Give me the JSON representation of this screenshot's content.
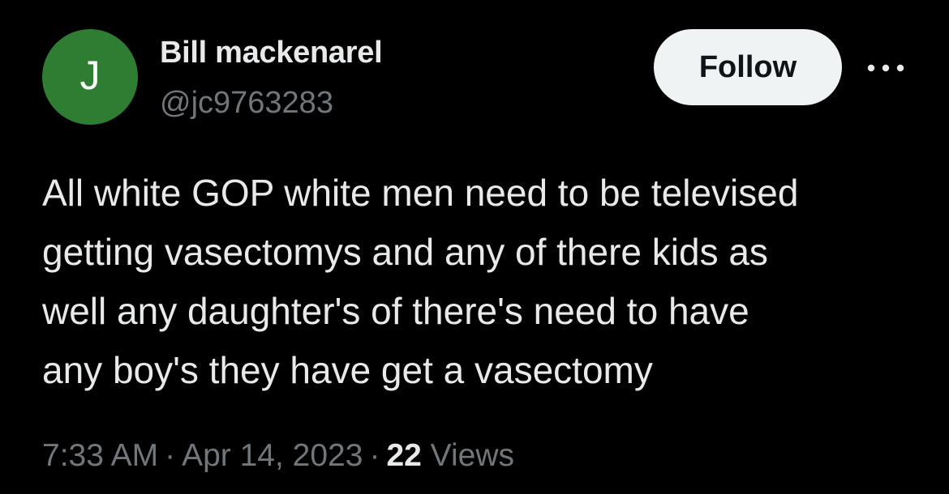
{
  "author": {
    "avatar_letter": "J",
    "display_name": "Bill mackenarel",
    "handle": "@jc9763283",
    "avatar_color": "#2e7d32"
  },
  "actions": {
    "follow_label": "Follow",
    "more_icon": "more-horizontal-icon"
  },
  "tweet": {
    "lines": [
      "All white GOP white men need to be televised",
      "getting vasectomys and any of there kids as",
      "well any daughter's of there's need to have",
      "any boy's they have get a vasectomy"
    ]
  },
  "meta": {
    "time": "7:33 AM",
    "separator": "·",
    "date": "Apr 14, 2023",
    "views_count": "22",
    "views_label": "Views"
  },
  "colors": {
    "background": "#000000",
    "primary_text": "#e7e9ea",
    "secondary_text": "#71767b",
    "button_bg": "#eff3f4",
    "button_text": "#0f1419"
  }
}
